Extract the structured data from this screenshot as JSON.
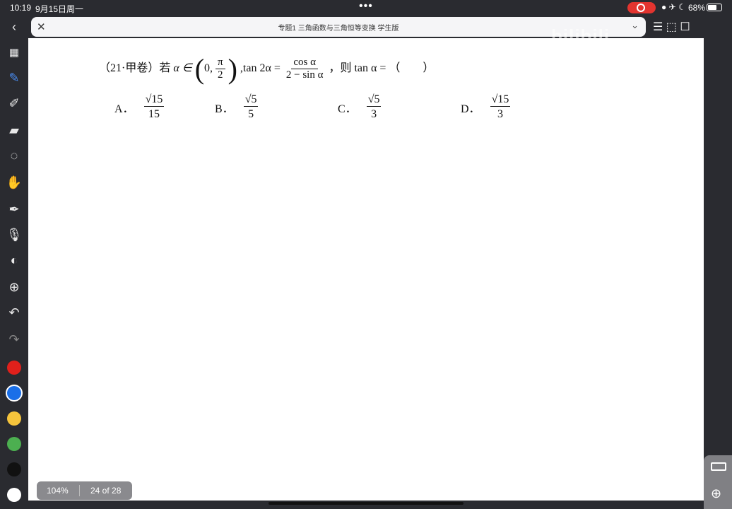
{
  "status": {
    "time": "10:19",
    "date": "9月15日周一",
    "battery": "68%"
  },
  "tab": {
    "title": "专题1 三角函数与三角恒等变换 学生版"
  },
  "watermark": "bilibili",
  "question": {
    "source": "（21·甲卷）若",
    "alpha_in": "α ∈",
    "interval_open": "0,",
    "pi_num": "π",
    "pi_den": "2",
    "tan_text": ",tan 2α =",
    "rhs_num": "cos α",
    "rhs_den": "2 − sin α",
    "tail": "，则 tan α = （　　）"
  },
  "choices": [
    {
      "label": "A．",
      "num": "√15",
      "den": "15"
    },
    {
      "label": "B．",
      "num": "√5",
      "den": "5"
    },
    {
      "label": "C．",
      "num": "√5",
      "den": "3"
    },
    {
      "label": "D．",
      "num": "√15",
      "den": "3"
    }
  ],
  "footer": {
    "zoom": "104%",
    "pages": "24 of 28"
  },
  "palette": [
    "#e0201b",
    "#1a6fe8",
    "#f5c43c",
    "#4caf50",
    "#111111",
    "#ffffff"
  ],
  "progress": {
    "battery_fraction": 0.68
  }
}
